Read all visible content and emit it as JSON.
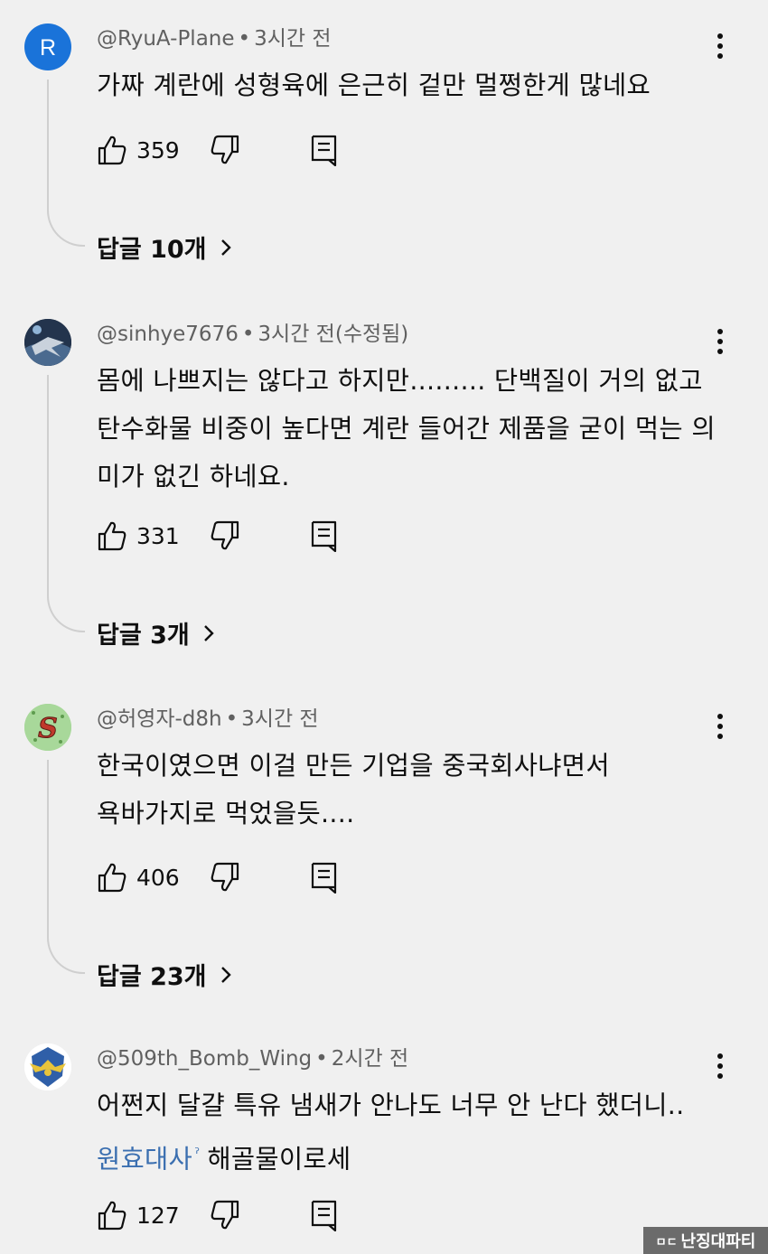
{
  "comments": [
    {
      "author": "@RyuA-Plane",
      "time": "3시간 전",
      "edited": "",
      "avatar_letter": "R",
      "text": "가짜 계란에 성형육에 은근히 겉만 멀쩡한게 많네요",
      "likes": "359",
      "replies_label": "답글 10개"
    },
    {
      "author": "@sinhye7676",
      "time": "3시간 전",
      "edited": "(수정됨)",
      "text": "몸에 나쁘지는 않다고 하지만......... 단백질이 거의 없고 탄수화물 비중이 높다면 계란 들어간 제품을 굳이 먹는 의미가 없긴 하네요.",
      "likes": "331",
      "replies_label": "답글 3개"
    },
    {
      "author": "@허영자-d8h",
      "time": "3시간 전",
      "edited": "",
      "avatar_letter": "S",
      "text": "한국이였으면 이걸 만든 기업을 중국회사냐면서 욕바가지로 먹었을듯....",
      "likes": "406",
      "replies_label": "답글 23개"
    },
    {
      "author": "@509th_Bomb_Wing",
      "time": "2시간 전",
      "edited": "",
      "text": "어쩐지 달걀 특유 냄새가 안나도 너무 안 난다 했더니..",
      "mention": "원효대사",
      "text_after": "해골물이로세",
      "likes": "127"
    }
  ],
  "colors": {
    "background": "#f0f0f0",
    "text": "#0f0f0f",
    "meta": "#606060",
    "mention": "#3b6fb0",
    "avatar_r": "#1a73d9"
  },
  "watermark": {
    "logo": "ㅁㄷ",
    "text": "난징대파티"
  }
}
